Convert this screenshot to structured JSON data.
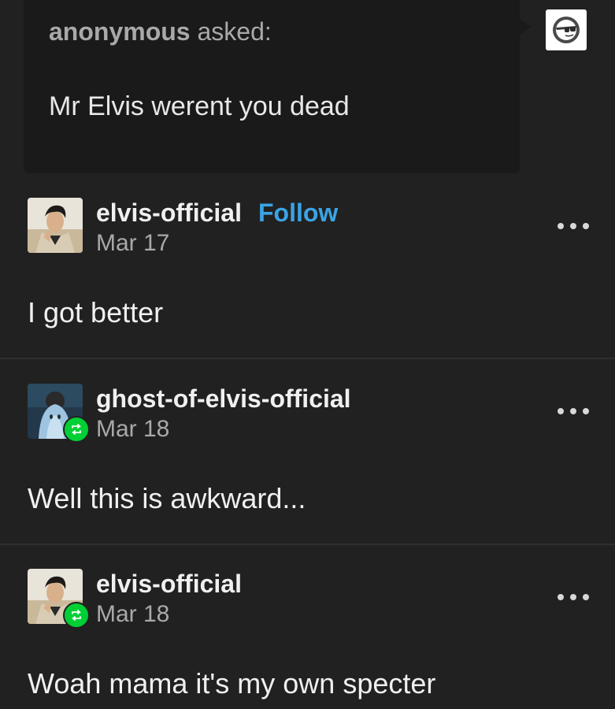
{
  "ask": {
    "asker": "anonymous",
    "asked_label": "asked:",
    "question": "Mr Elvis werent you dead",
    "avatar_icon": "sunglasses-face-icon"
  },
  "posts": [
    {
      "username": "elvis-official",
      "follow_label": "Follow",
      "date": "Mar 17",
      "text": "I got better",
      "reblogged": false
    },
    {
      "username": "ghost-of-elvis-official",
      "date": "Mar 18",
      "text": "Well this is awkward...",
      "reblogged": true
    },
    {
      "username": "elvis-official",
      "date": "Mar 18",
      "text": "Woah mama it's my own specter",
      "reblogged": true
    }
  ],
  "colors": {
    "background": "#212121",
    "ask_background": "#1a1a1a",
    "follow_blue": "#3aa4e6",
    "reblog_green": "#00cf35"
  }
}
